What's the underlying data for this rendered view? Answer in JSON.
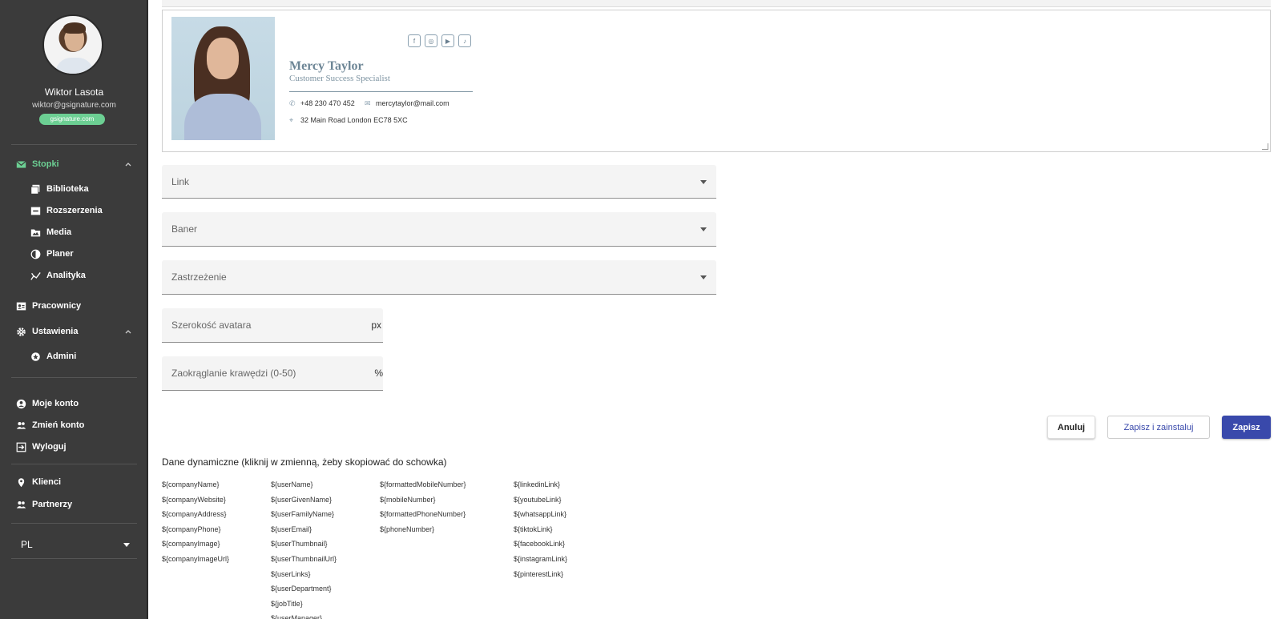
{
  "sidebar": {
    "user_name": "Wiktor Lasota",
    "user_email": "wiktor@gsignature.com",
    "domain_badge": "gsignature.com",
    "accent_color": "#6ccf93",
    "nav": [
      {
        "label": "Stopki",
        "icon": "mail-icon",
        "active": true,
        "expanded": true
      },
      {
        "label": "Biblioteka",
        "icon": "library-icon"
      },
      {
        "label": "Rozszerzenia",
        "icon": "extension-icon"
      },
      {
        "label": "Media",
        "icon": "media-icon"
      },
      {
        "label": "Planer",
        "icon": "planner-icon"
      },
      {
        "label": "Analityka",
        "icon": "analytics-icon"
      },
      {
        "label": "Pracownicy",
        "icon": "employees-icon"
      },
      {
        "label": "Ustawienia",
        "icon": "gear-icon",
        "expanded": true
      },
      {
        "label": "Admini",
        "icon": "admin-icon"
      },
      {
        "label": "Moje konto",
        "icon": "account-icon"
      },
      {
        "label": "Zmień konto",
        "icon": "switch-account-icon"
      },
      {
        "label": "Wyloguj",
        "icon": "logout-icon"
      },
      {
        "label": "Klienci",
        "icon": "pin-icon"
      },
      {
        "label": "Partnerzy",
        "icon": "partners-icon"
      }
    ],
    "language": "PL"
  },
  "signature": {
    "name": "Mercy Taylor",
    "title": "Customer Success Specialist",
    "phone": "+48 230 470 452",
    "email": "mercytaylor@mail.com",
    "address": "32 Main Road London EC78 5XC",
    "socials": [
      "facebook-icon",
      "instagram-icon",
      "youtube-icon",
      "tiktok-icon"
    ]
  },
  "form": {
    "link_label": "Link",
    "banner_label": "Baner",
    "disclaimer_label": "Zastrzeżenie",
    "avatar_width_label": "Szerokość avatara",
    "avatar_width_suffix": "px",
    "corner_radius_label": "Zaokrąglanie krawędzi (0-50)",
    "corner_radius_suffix": "%"
  },
  "actions": {
    "cancel": "Anuluj",
    "save_install": "Zapisz i zainstaluj",
    "save": "Zapisz",
    "primary_color": "#3949ab"
  },
  "dynamic": {
    "title": "Dane dynamiczne (kliknij w zmienną, żeby skopiować do schowka)",
    "columns": [
      [
        "${companyName}",
        "${companyWebsite}",
        "${companyAddress}",
        "${companyPhone}",
        "${companyImage}",
        "${companyImageUrl}"
      ],
      [
        "${userName}",
        "${userGivenName}",
        "${userFamilyName}",
        "${userEmail}",
        "${userThumbnail}",
        "${userThumbnailUrl}",
        "${userLinks}",
        "${userDepartment}",
        "${jobTitle}",
        "${userManager}"
      ],
      [
        "${formattedMobileNumber}",
        "${mobileNumber}",
        "${formattedPhoneNumber}",
        "${phoneNumber}"
      ],
      [
        "${linkedinLink}",
        "${youtubeLink}",
        "${whatsappLink}",
        "${tiktokLink}",
        "${facebookLink}",
        "${instagramLink}",
        "${pinterestLink}"
      ]
    ]
  }
}
